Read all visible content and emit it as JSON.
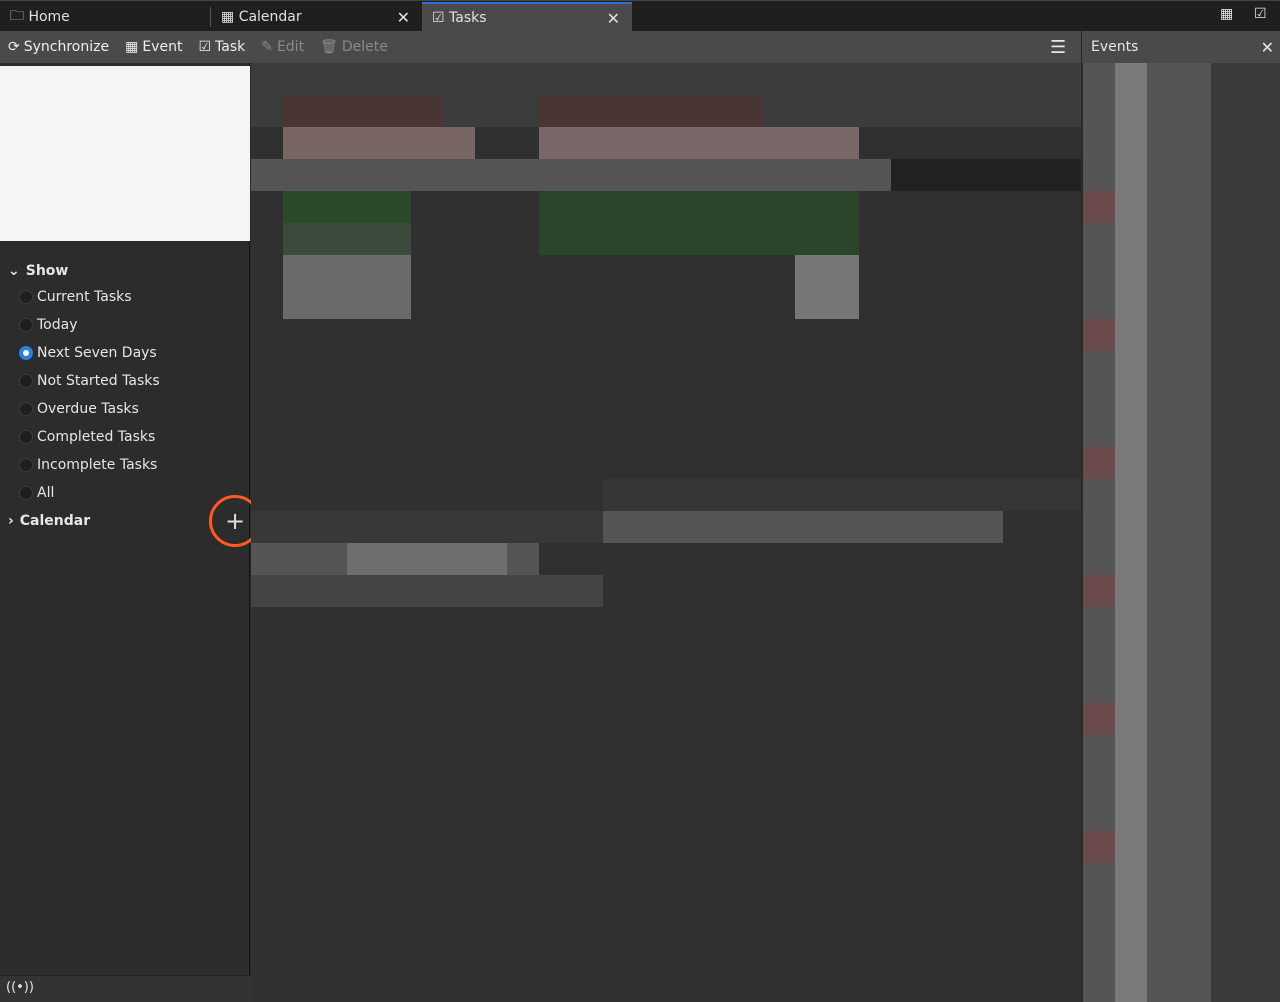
{
  "tabs": [
    {
      "label": "Home",
      "icon": "folder-icon"
    },
    {
      "label": "Calendar",
      "icon": "calendar-icon"
    },
    {
      "label": "Tasks",
      "icon": "tasks-icon",
      "selected": true
    }
  ],
  "toolbar": {
    "synchronize": "Synchronize",
    "event": "Event",
    "task": "Task",
    "edit": "Edit",
    "delete": "Delete"
  },
  "events_pane": {
    "title": "Events"
  },
  "sidebar": {
    "show_label": "Show",
    "filters": [
      {
        "label": "Current Tasks"
      },
      {
        "label": "Today"
      },
      {
        "label": "Next Seven Days",
        "selected": true
      },
      {
        "label": "Not Started Tasks"
      },
      {
        "label": "Overdue Tasks"
      },
      {
        "label": "Completed Tasks"
      },
      {
        "label": "Incomplete Tasks"
      },
      {
        "label": "All"
      }
    ],
    "calendar_label": "Calendar"
  },
  "colors": {
    "accent": "#2a7fe0",
    "highlight": "#ff5a1f"
  }
}
